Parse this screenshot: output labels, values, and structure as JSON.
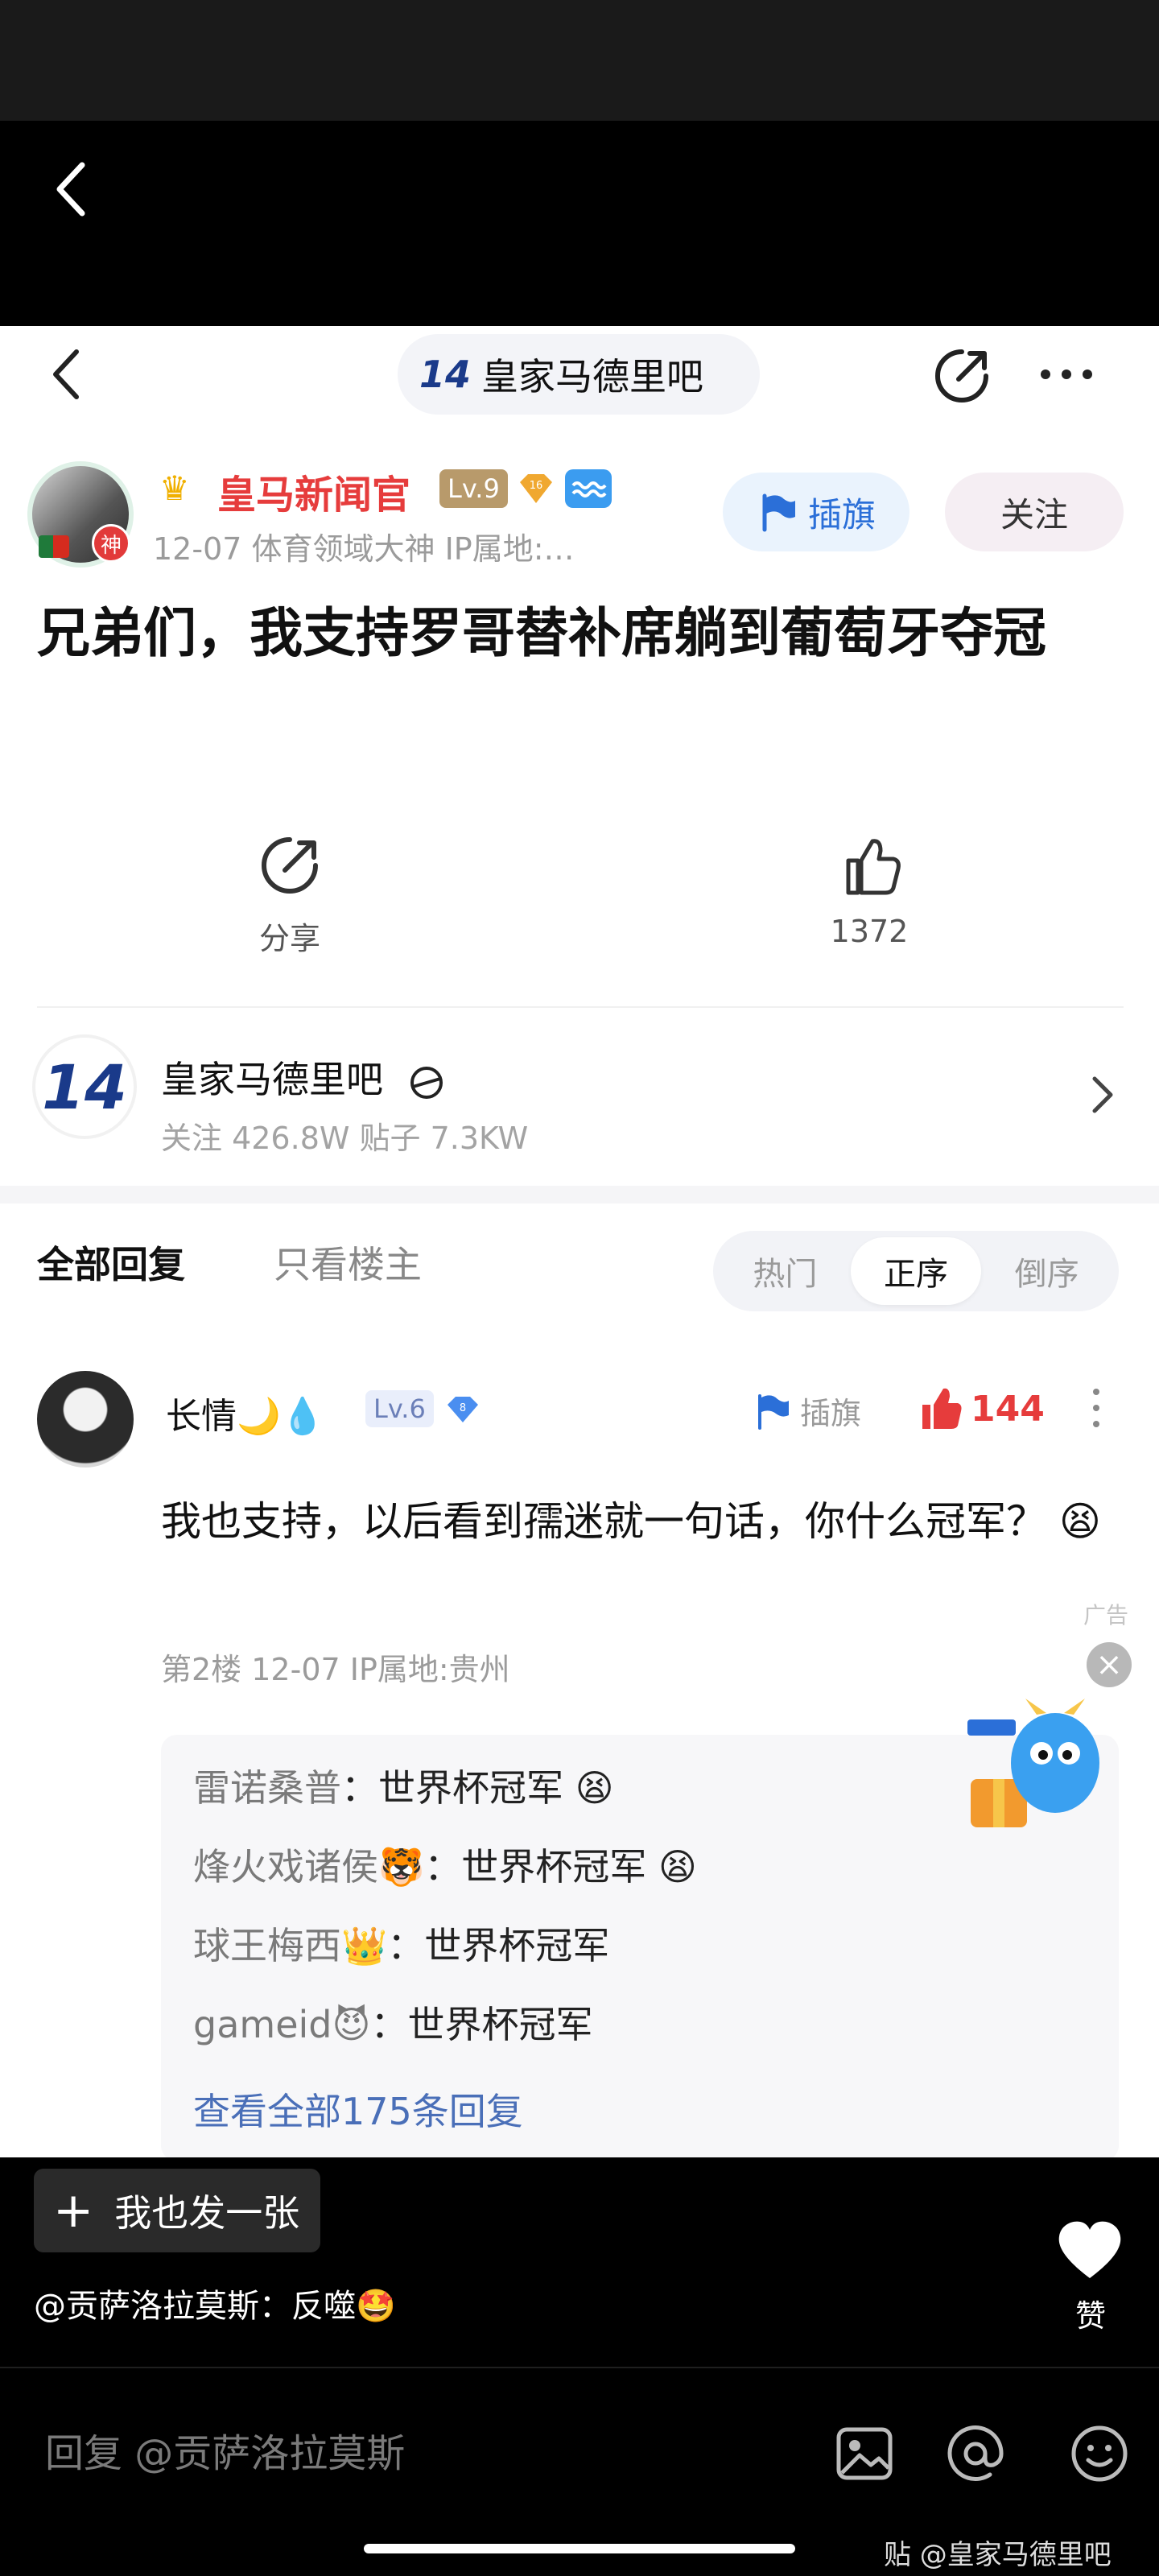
{
  "nav": {
    "forum_logo_text": "14",
    "title": "皇家马德里吧"
  },
  "post": {
    "author": {
      "name": "皇马新闻官",
      "god_badge": "神",
      "level": "Lv.9",
      "gem_value": "16"
    },
    "meta": "12-07   体育领域大神   IP属地:…",
    "flag_label": "插旗",
    "follow_label": "关注",
    "title": "兄弟们，我支持罗哥替补席躺到葡萄牙夺冠",
    "share_label": "分享",
    "like_count": "1372"
  },
  "forum_card": {
    "logo_text": "14",
    "name": "皇家马德里吧",
    "stats": "关注 426.8W   贴子 7.3KW"
  },
  "reply_tabs": {
    "all": "全部回复",
    "author_only": "只看楼主",
    "sort": [
      "热门",
      "正序",
      "倒序"
    ],
    "active_sort": "正序"
  },
  "comment": {
    "name": "长情🌙💧",
    "level": "Lv.6",
    "gem_value": "8",
    "flag_label": "插旗",
    "like_count": "144",
    "text": "我也支持，以后看到孺迷就一句话，你什么冠军？ 😫",
    "meta": "第2楼   12-07   IP属地:贵州",
    "sub_replies": [
      {
        "who": "雷诺桑普",
        "text": "：世界杯冠军 😫"
      },
      {
        "who": "烽火戏诸侯🐯",
        "text": "：世界杯冠军 😫"
      },
      {
        "who": "球王梅西👑",
        "text": "：世界杯冠军"
      },
      {
        "who": "gameid😈",
        "text": "：世界杯冠军"
      }
    ],
    "view_all": "查看全部175条回复"
  },
  "ad": {
    "tag": "广告",
    "close": "×"
  },
  "bottom": {
    "post_one_label": "我也发一张",
    "mention": "@贡萨洛拉莫斯：反噬🤩",
    "like_label": "赞",
    "reply_placeholder": "回复 @贡萨洛拉莫斯",
    "watermark": "贴 @皇家马德里吧"
  },
  "colors": {
    "accent_red": "#e63c3c",
    "link_blue": "#4a6fb8",
    "flag_blue": "#2b6fd8"
  }
}
